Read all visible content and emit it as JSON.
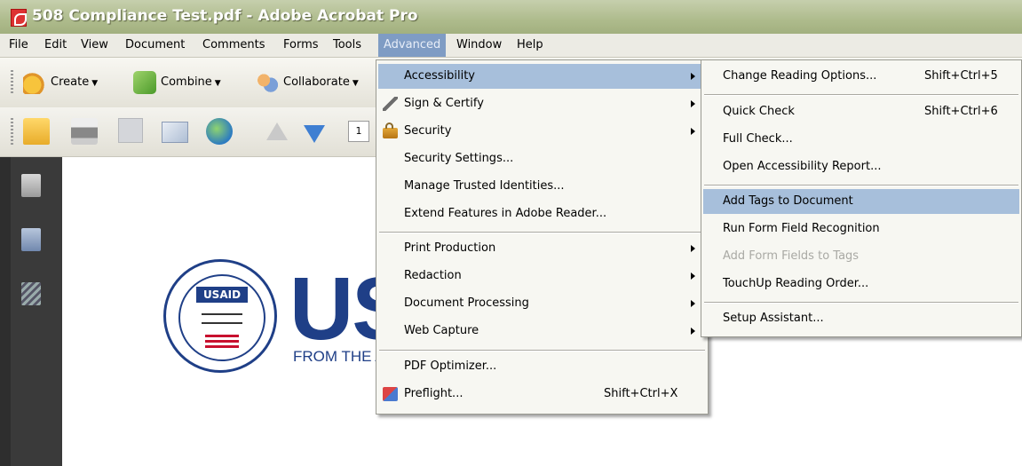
{
  "window": {
    "title": "508 Compliance Test.pdf - Adobe Acrobat Pro"
  },
  "menubar": {
    "items": [
      {
        "label": "File"
      },
      {
        "label": "Edit"
      },
      {
        "label": "View"
      },
      {
        "label": "Document"
      },
      {
        "label": "Comments"
      },
      {
        "label": "Forms"
      },
      {
        "label": "Tools"
      },
      {
        "label": "Advanced"
      },
      {
        "label": "Window"
      },
      {
        "label": "Help"
      }
    ],
    "active": "Advanced"
  },
  "toolbar": {
    "create_label": "Create",
    "combine_label": "Combine",
    "collaborate_label": "Collaborate",
    "page_number": "1"
  },
  "document": {
    "seal_text": "USAID",
    "logo_text": "USAID",
    "tagline": "FROM THE AMERICAN PEOPLE"
  },
  "advanced_menu": {
    "items": [
      {
        "label": "Accessibility",
        "submenu": true,
        "highlighted": true,
        "icon": null
      },
      {
        "label": "Sign & Certify",
        "submenu": true,
        "icon": "pen-icon"
      },
      {
        "label": "Security",
        "submenu": true,
        "icon": "lock-icon"
      },
      {
        "label": "Security Settings..."
      },
      {
        "label": "Manage Trusted Identities..."
      },
      {
        "label": "Extend Features in Adobe Reader..."
      },
      {
        "label": "Print Production",
        "submenu": true
      },
      {
        "label": "Redaction",
        "submenu": true
      },
      {
        "label": "Document Processing",
        "submenu": true
      },
      {
        "label": "Web Capture",
        "submenu": true
      },
      {
        "label": "PDF Optimizer..."
      },
      {
        "label": "Preflight...",
        "shortcut": "Shift+Ctrl+X",
        "icon": "preflight-icon"
      }
    ]
  },
  "accessibility_menu": {
    "items": [
      {
        "label": "Change Reading Options...",
        "shortcut": "Shift+Ctrl+5"
      },
      {
        "label": "Quick Check",
        "shortcut": "Shift+Ctrl+6"
      },
      {
        "label": "Full Check..."
      },
      {
        "label": "Open Accessibility Report..."
      },
      {
        "label": "Add Tags to Document",
        "highlighted": true
      },
      {
        "label": "Run Form Field Recognition"
      },
      {
        "label": "Add Form Fields to Tags",
        "disabled": true
      },
      {
        "label": "TouchUp Reading Order..."
      },
      {
        "label": "Setup Assistant..."
      }
    ]
  },
  "colors": {
    "titlebar": "#aebb8c",
    "menu_highlight": "#a7bfdb",
    "active_menu": "#7f9cc4",
    "usaid_blue": "#1f3f87"
  }
}
